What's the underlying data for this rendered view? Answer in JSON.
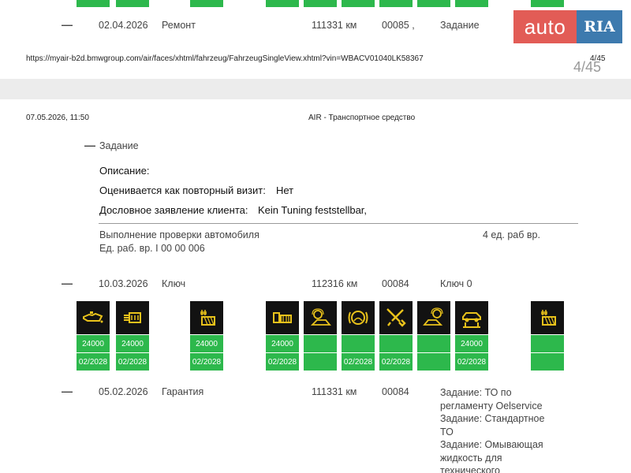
{
  "top_row": {
    "dash": "—",
    "date": "02.04.2026",
    "type": "Ремонт",
    "mileage": "111331 км",
    "code": "00085 ,",
    "task": "Задание"
  },
  "url_line": {
    "url": "https://myair-b2d.bmwgroup.com/air/faces/xhtml/fahrzeug/FahrzeugSingleView.xhtml?vin=WBACV01040LK58367",
    "page_small": "4/45",
    "page_big": "4/45"
  },
  "watermark": {
    "auto": "auto",
    "ria": "RIA"
  },
  "page_header": {
    "datetime": "07.05.2026, 11:50",
    "title": "AIR - Транспортное средство"
  },
  "task_block": {
    "dash": "—",
    "heading": "Задание",
    "description_label": "Описание:",
    "repeat_visit_label": "Оценивается как повторный визит:",
    "repeat_visit_value": "Нет",
    "statement_label": "Дословное заявление клиента:",
    "statement_value": "Kein Tuning feststellbar,",
    "check_line1": "Выполнение проверки автомобиля",
    "check_line2": "Ед. раб. вр. I 00 00 006",
    "check_units": "4 ед. раб вр."
  },
  "key_row": {
    "dash": "—",
    "date": "10.03.2026",
    "type": "Ключ",
    "mileage": "112316 км",
    "code": "00084",
    "task": "Ключ 0"
  },
  "service_tiles": [
    {
      "icon": "engine-oil-icon",
      "line1": "24000",
      "line2": "02/2028"
    },
    {
      "icon": "particulate-filter-icon",
      "line1": "24000",
      "line2": "02/2028"
    },
    {
      "icon": "microfilter-icon",
      "line1": "24000",
      "line2": "02/2028"
    },
    {
      "icon": "fuel-filter-icon",
      "line1": "24000",
      "line2": "02/2028"
    },
    {
      "icon": "brake-pads-front-icon",
      "line1": "",
      "line2": ""
    },
    {
      "icon": "brake-fluid-icon",
      "line1": "",
      "line2": "02/2028"
    },
    {
      "icon": "vehicle-check-icon",
      "line1": "",
      "line2": "02/2028"
    },
    {
      "icon": "brake-pads-rear-icon",
      "line1": "",
      "line2": ""
    },
    {
      "icon": "vehicle-inspection-icon",
      "line1": "24000",
      "line2": "02/2028"
    },
    {
      "icon": "microfilter-2-icon",
      "line1": "",
      "line2": ""
    }
  ],
  "warranty_row": {
    "dash": "—",
    "date": "05.02.2026",
    "type": "Гарантия",
    "mileage": "111331 км",
    "code": "00084",
    "task_lines": [
      "Задание: ТО по",
      "регламенту Oelservice",
      "Задание: Стандартное",
      "ТО",
      "Задание: Омывающая",
      "жидкость для",
      "технического"
    ]
  },
  "colors": {
    "tile_green": "#2db84c",
    "tile_dark": "#121212",
    "icon_yellow": "#e9c21b",
    "logo_red": "#e25c56",
    "logo_blue": "#2d6fa8"
  }
}
